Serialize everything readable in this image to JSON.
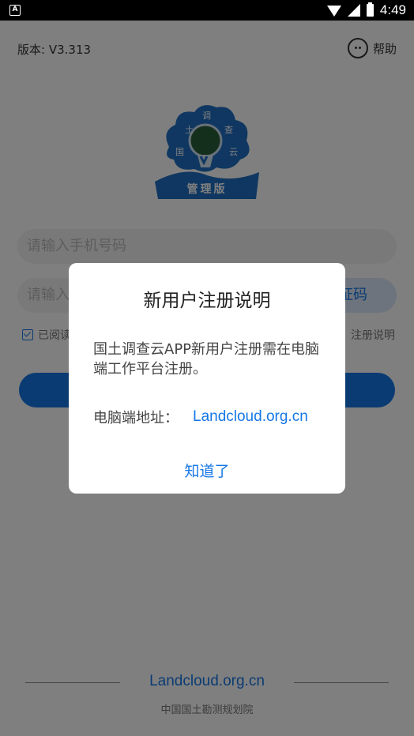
{
  "status": {
    "time": "4:49",
    "left_badge": "A"
  },
  "header": {
    "version": "版本: V3.313",
    "help_label": "帮助"
  },
  "logo": {
    "chars_top": "调",
    "chars_left": "土",
    "chars_right": "查",
    "chars_bl": "国",
    "chars_br": "云",
    "banner": "管理版",
    "brand_blue": "#1e6fc2"
  },
  "form": {
    "phone_placeholder": "请输入手机号码",
    "code_placeholder": "请输入",
    "code_button": "证码",
    "agree_text": "已阅读",
    "reg_note": "注册说明"
  },
  "footer": {
    "domain": "Landcloud.org.cn",
    "org": "中国国土勘测规划院"
  },
  "dialog": {
    "title": "新用户注册说明",
    "body": "国土调查云APP新用户注册需在电脑端工作平台注册。",
    "addr_label": "电脑端地址：",
    "addr_link": "Landcloud.org.cn",
    "ok_button": "知道了"
  },
  "colors": {
    "accent": "#1677e6"
  }
}
